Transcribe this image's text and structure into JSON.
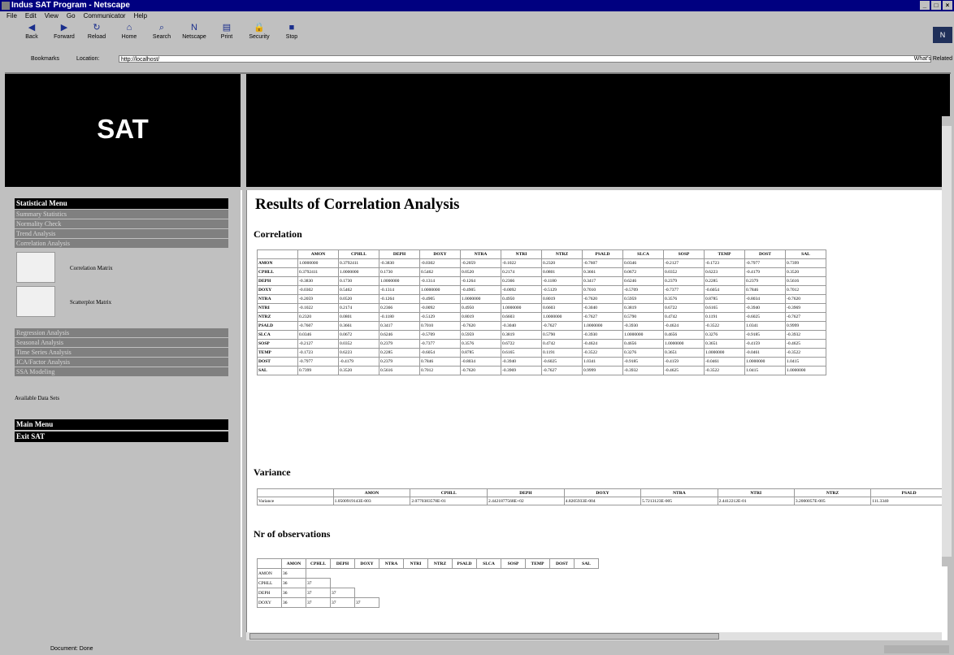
{
  "window": {
    "title": "Indus SAT Program - Netscape"
  },
  "menu": [
    "File",
    "Edit",
    "View",
    "Go",
    "Communicator",
    "Help"
  ],
  "toolbar": [
    {
      "label": "Back",
      "icon": "back-arrow-icon"
    },
    {
      "label": "Forward",
      "icon": "forward-arrow-icon"
    },
    {
      "label": "Reload",
      "icon": "reload-icon"
    },
    {
      "label": "Home",
      "icon": "home-icon"
    },
    {
      "label": "Search",
      "icon": "search-icon"
    },
    {
      "label": "Netscape",
      "icon": "netscape-icon"
    },
    {
      "label": "Print",
      "icon": "print-icon"
    },
    {
      "label": "Security",
      "icon": "security-icon"
    },
    {
      "label": "Stop",
      "icon": "stop-icon"
    }
  ],
  "location": {
    "bookmarks": "Bookmarks",
    "label": "Location:",
    "url": "http://localhost/",
    "related": "What's Related"
  },
  "banner": {
    "title": "SAT"
  },
  "sidebar": {
    "statistical_menu": "Statistical Menu",
    "items1": [
      "Summary Statistics",
      "Normality Check",
      "Trend Analysis",
      "Correlation Analysis"
    ],
    "sub": [
      {
        "label": "Correlation Matrix"
      },
      {
        "label": "Scatterplot Matrix"
      }
    ],
    "items2": [
      "Regression Analysis",
      "Seasonal Analysis",
      "Time Series Analysis",
      "ICA/Factor Analysis",
      "SSA Modeling"
    ],
    "available": "Available Data Sets",
    "main_menu": "Main Menu",
    "exit": "Exit SAT"
  },
  "main": {
    "title": "Results of Correlation Analysis",
    "correlation_heading": "Correlation",
    "variance_heading": "Variance",
    "obs_heading": "Nr of observations"
  },
  "variables": [
    "AMON",
    "CPHLL",
    "DEPH",
    "DOXY",
    "NTRA",
    "NTRI",
    "NTRZ",
    "PSALD",
    "SLCA",
    "SOSP",
    "TEMP",
    "DOST",
    "SAL"
  ],
  "correlation": [
    [
      "1.0000000",
      "0.3792411",
      "-0.3830",
      "-0.0302",
      "-0.2059",
      "-0.1022",
      "0.2320",
      "-0.7607",
      "0.0346",
      "-0.2127",
      "-0.1723",
      "-0.7977",
      "0.7399"
    ],
    [
      "0.3792411",
      "1.0000000",
      "0.1730",
      "0.5462",
      "0.0520",
      "0.2174",
      "0.0801",
      "0.3661",
      "0.0672",
      "0.0352",
      "0.6223",
      "-0.4179",
      "0.3520"
    ],
    [
      "-0.3830",
      "0.1730",
      "1.0000000",
      "-0.1314",
      "-0.1264",
      "0.2366",
      "-0.1180",
      "0.3417",
      "0.6246",
      "0.2379",
      "0.2285",
      "0.2379",
      "0.5616"
    ],
    [
      "-0.0302",
      "0.5462",
      "-0.1314",
      "1.0000000",
      "-0.4905",
      "-0.0092",
      "-0.5129",
      "0.7010",
      "-0.5709",
      "-0.7377",
      "-0.6054",
      "0.7846",
      "0.7012"
    ],
    [
      "-0.2059",
      "0.0520",
      "-0.1264",
      "-0.4905",
      "1.0000000",
      "0.4950",
      "0.8019",
      "-0.7620",
      "0.5959",
      "0.3576",
      "0.8785",
      "-0.8034",
      "-0.7620"
    ],
    [
      "-0.1022",
      "0.2174",
      "0.2366",
      "-0.0092",
      "0.4950",
      "1.0000000",
      "0.6603",
      "-0.3040",
      "0.3819",
      "0.6722",
      "0.6165",
      "-0.3940",
      "-0.3969"
    ],
    [
      "0.2320",
      "0.0801",
      "-0.1180",
      "-0.5129",
      "0.8019",
      "0.6603",
      "1.0000000",
      "-0.7627",
      "0.5790",
      "0.4742",
      "0.1191",
      "-0.6025",
      "-0.7627"
    ],
    [
      "-0.7607",
      "0.3661",
      "0.3417",
      "0.7010",
      "-0.7620",
      "-0.3040",
      "-0.7627",
      "1.0000000",
      "-0.3930",
      "-0.4624",
      "-0.3522",
      "1.0341",
      "0.9999"
    ],
    [
      "0.0346",
      "0.0672",
      "0.6246",
      "-0.5709",
      "0.5959",
      "0.3819",
      "0.5790",
      "-0.3930",
      "1.0000000",
      "0.4656",
      "0.3276",
      "-0.9185",
      "-0.3932"
    ],
    [
      "-0.2127",
      "0.0352",
      "0.2379",
      "-0.7377",
      "0.3576",
      "0.6722",
      "0.4742",
      "-0.4624",
      "0.4656",
      "1.0000000",
      "0.3651",
      "-0.4159",
      "-0.4625"
    ],
    [
      "-0.1723",
      "0.6223",
      "0.2285",
      "-0.6054",
      "0.8785",
      "0.6165",
      "0.1191",
      "-0.3522",
      "0.3276",
      "0.3651",
      "1.0000000",
      "-0.0461",
      "-0.3522"
    ],
    [
      "-0.7977",
      "-0.4179",
      "0.2379",
      "0.7846",
      "-0.8034",
      "-0.3940",
      "-0.6025",
      "1.0341",
      "-0.9185",
      "-0.4159",
      "-0.0461",
      "1.0000000",
      "1.0415"
    ],
    [
      "0.7399",
      "0.3520",
      "0.5616",
      "0.7012",
      "-0.7620",
      "-0.3969",
      "-0.7627",
      "0.9999",
      "-0.3932",
      "-0.4625",
      "-0.3522",
      "1.0415",
      "1.0000000"
    ]
  ],
  "variance": {
    "row_label": "Variance",
    "headers": [
      "AMON",
      "CPHLL",
      "DEPH",
      "DOXY",
      "NTRA",
      "NTRI",
      "NTRZ",
      "PSALD"
    ],
    "values": [
      "1.0500919143E-003",
      "2.0770383578E-01",
      "2.4421877568E+02",
      "4.8205933E-004",
      "5.7213123E-005",
      "2.4412212E-01",
      "3.2000057E-005",
      "111.3340"
    ]
  },
  "observations": {
    "rows": [
      {
        "label": "AMON",
        "values": [
          "36"
        ]
      },
      {
        "label": "CPHLL",
        "values": [
          "36",
          "37"
        ]
      },
      {
        "label": "DEPH",
        "values": [
          "36",
          "37",
          "37"
        ]
      },
      {
        "label": "DOXY",
        "values": [
          "36",
          "37",
          "37",
          "37"
        ]
      }
    ]
  },
  "status": {
    "text": "Document: Done"
  }
}
